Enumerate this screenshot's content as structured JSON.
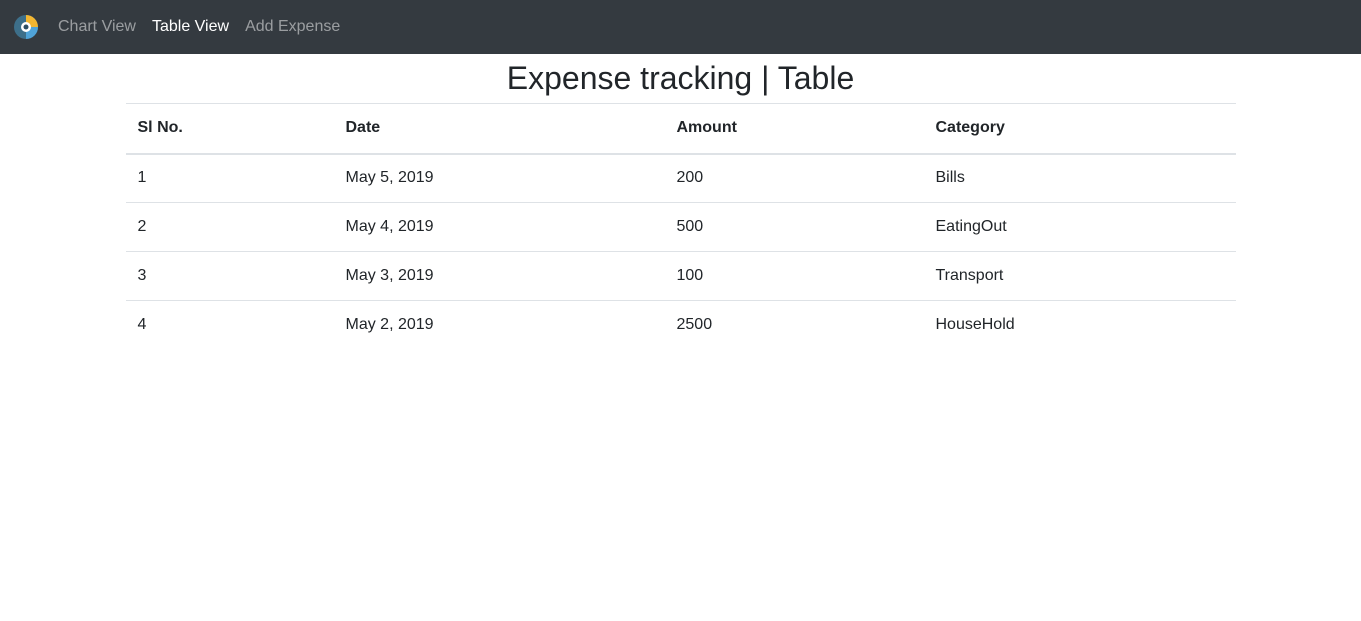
{
  "nav": {
    "logo_icon": "app-logo-icon",
    "links": [
      {
        "label": "Chart View",
        "active": false
      },
      {
        "label": "Table View",
        "active": true
      },
      {
        "label": "Add Expense",
        "active": false
      }
    ]
  },
  "page": {
    "title": "Expense tracking | Table"
  },
  "table": {
    "headers": [
      "Sl No.",
      "Date",
      "Amount",
      "Category"
    ],
    "rows": [
      [
        "1",
        "May 5, 2019",
        "200",
        "Bills"
      ],
      [
        "2",
        "May 4, 2019",
        "500",
        "EatingOut"
      ],
      [
        "3",
        "May 3, 2019",
        "100",
        "Transport"
      ],
      [
        "4",
        "May 2, 2019",
        "2500",
        "HouseHold"
      ]
    ]
  },
  "colors": {
    "navbar_bg": "#343a40",
    "nav_active": "#ffffff",
    "nav_inactive": "rgba(255,255,255,0.5)",
    "text": "#212529",
    "border": "#dee2e6"
  }
}
